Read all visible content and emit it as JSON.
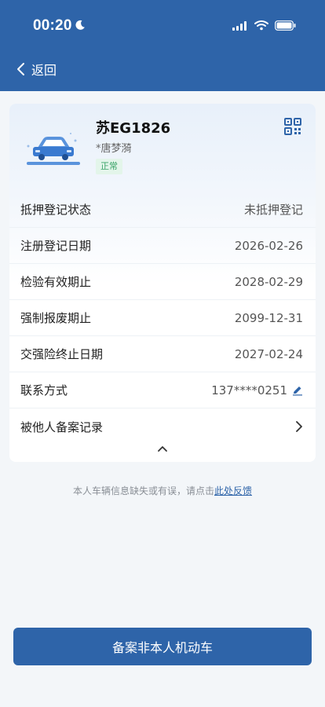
{
  "status_bar": {
    "time": "00:20"
  },
  "nav": {
    "back_label": "返回"
  },
  "vehicle": {
    "plate": "苏EG1826",
    "owner": "*唐梦漪",
    "status": "正常"
  },
  "details": [
    {
      "label": "抵押登记状态",
      "value": "未抵押登记"
    },
    {
      "label": "注册登记日期",
      "value": "2026-02-26"
    },
    {
      "label": "检验有效期止",
      "value": "2028-02-29"
    },
    {
      "label": "强制报废期止",
      "value": "2099-12-31"
    },
    {
      "label": "交强险终止日期",
      "value": "2027-02-24"
    },
    {
      "label": "联系方式",
      "value": "137****0251"
    },
    {
      "label": "被他人备案记录",
      "value": ""
    }
  ],
  "feedback": {
    "text": "本人车辆信息缺失或有误，请点击",
    "link": "此处反馈"
  },
  "primary_button": {
    "label": "备案非本人机动车"
  },
  "colors": {
    "brand": "#2e64a9",
    "status_green": "#3aa368"
  }
}
